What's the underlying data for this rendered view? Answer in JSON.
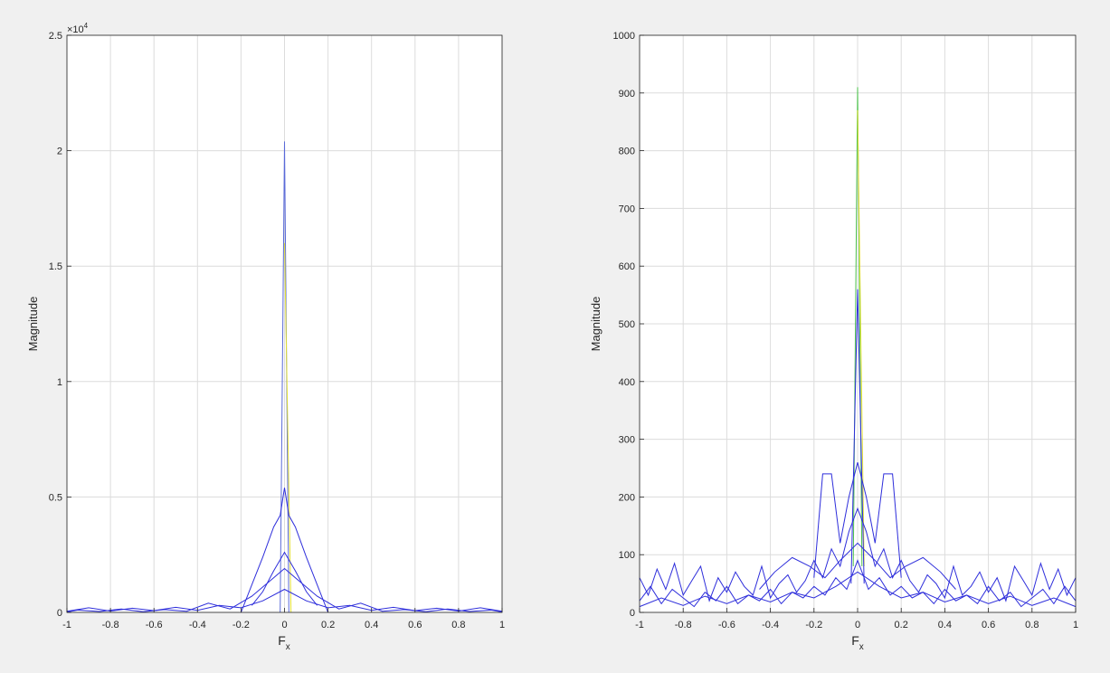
{
  "chart_data": [
    {
      "type": "line",
      "title": "",
      "xlabel": "F",
      "xlabel_sub": "x",
      "ylabel": "Magnitude",
      "xlim": [
        -1,
        1
      ],
      "ylim": [
        0,
        25000
      ],
      "grid": true,
      "y_exponent_label": "×10",
      "y_exponent_power": "4",
      "x_ticks": [
        "-1",
        "-0.8",
        "-0.6",
        "-0.4",
        "-0.2",
        "0",
        "0.2",
        "0.4",
        "0.6",
        "0.8",
        "1"
      ],
      "y_ticks": [
        "0",
        "0.5",
        "1",
        "1.5",
        "2",
        "2.5"
      ],
      "series": [
        {
          "color": "#5a6ad8",
          "x": [
            -0.02,
            0,
            0.02
          ],
          "y": [
            0,
            20400,
            0
          ]
        },
        {
          "color": "#e3e033",
          "x": [
            0,
            0.03
          ],
          "y": [
            16000,
            0
          ]
        },
        {
          "color": "#2e2edb",
          "x": [
            -0.2,
            -0.15,
            -0.1,
            -0.05,
            -0.02,
            0,
            0.02,
            0.05,
            0.1,
            0.15,
            0.2
          ],
          "y": [
            0,
            1200,
            2400,
            3700,
            4200,
            5400,
            4200,
            3700,
            2400,
            1200,
            0
          ]
        },
        {
          "color": "#2e2edb",
          "x": [
            -0.15,
            -0.1,
            -0.05,
            0,
            0.05,
            0.1,
            0.15
          ],
          "y": [
            300,
            900,
            1800,
            2600,
            1800,
            900,
            300
          ]
        },
        {
          "color": "#2e2edb",
          "x": [
            -1,
            -0.9,
            -0.8,
            -0.7,
            -0.6,
            -0.5,
            -0.4,
            -0.3,
            -0.2,
            -0.1,
            0,
            0.1,
            0.2,
            0.3,
            0.4,
            0.5,
            0.6,
            0.7,
            0.8,
            0.9,
            1
          ],
          "y": [
            50,
            200,
            60,
            180,
            80,
            220,
            90,
            300,
            200,
            500,
            1000,
            500,
            200,
            300,
            90,
            220,
            80,
            180,
            60,
            200,
            50
          ]
        },
        {
          "color": "#2e2edb",
          "x": [
            -1,
            -0.95,
            -0.85,
            -0.75,
            -0.65,
            -0.55,
            -0.45,
            -0.35,
            -0.25,
            -0.15,
            -0.05,
            0,
            0.05,
            0.15,
            0.25,
            0.35,
            0.45,
            0.55,
            0.65,
            0.75,
            0.85,
            0.95,
            1
          ],
          "y": [
            20,
            100,
            40,
            150,
            30,
            120,
            50,
            400,
            150,
            700,
            1500,
            1900,
            1500,
            700,
            150,
            400,
            50,
            120,
            30,
            150,
            40,
            100,
            20
          ]
        }
      ]
    },
    {
      "type": "line",
      "title": "",
      "xlabel": "F",
      "xlabel_sub": "x",
      "ylabel": "Magnitude",
      "xlim": [
        -1,
        1
      ],
      "ylim": [
        0,
        1000
      ],
      "grid": true,
      "x_ticks": [
        "-1",
        "-0.8",
        "-0.6",
        "-0.4",
        "-0.2",
        "0",
        "0.2",
        "0.4",
        "0.6",
        "0.8",
        "1"
      ],
      "y_ticks": [
        "0",
        "100",
        "200",
        "300",
        "400",
        "500",
        "600",
        "700",
        "800",
        "900",
        "1000"
      ],
      "series": [
        {
          "color": "#4dc24d",
          "x": [
            -0.02,
            0,
            0.02
          ],
          "y": [
            80,
            910,
            80
          ]
        },
        {
          "color": "#e3e033",
          "x": [
            0,
            0.03
          ],
          "y": [
            870,
            80
          ]
        },
        {
          "color": "#2e2edb",
          "x": [
            -0.03,
            0,
            0.03
          ],
          "y": [
            50,
            560,
            50
          ]
        },
        {
          "color": "#2e2edb",
          "x": [
            -0.2,
            -0.16,
            -0.12,
            -0.08,
            -0.04,
            0,
            0.04,
            0.08,
            0.12,
            0.16,
            0.2
          ],
          "y": [
            60,
            240,
            240,
            120,
            200,
            260,
            200,
            120,
            240,
            240,
            60
          ]
        },
        {
          "color": "#2e2edb",
          "x": [
            -0.45,
            -0.38,
            -0.3,
            -0.22,
            -0.15,
            -0.08,
            0,
            0.08,
            0.15,
            0.22,
            0.3,
            0.38,
            0.45
          ],
          "y": [
            40,
            70,
            95,
            80,
            60,
            90,
            120,
            90,
            60,
            80,
            95,
            70,
            40
          ]
        },
        {
          "color": "#2e2edb",
          "x": [
            -1,
            -0.96,
            -0.92,
            -0.88,
            -0.84,
            -0.8,
            -0.76,
            -0.72,
            -0.68,
            -0.64,
            -0.6,
            -0.56,
            -0.52,
            -0.48,
            -0.44,
            -0.4,
            -0.36,
            -0.32,
            -0.28,
            -0.24,
            -0.2,
            -0.16,
            -0.12,
            -0.08,
            -0.04,
            0,
            0.04,
            0.08,
            0.12,
            0.16,
            0.2,
            0.24,
            0.28,
            0.32,
            0.36,
            0.4,
            0.44,
            0.48,
            0.52,
            0.56,
            0.6,
            0.64,
            0.68,
            0.72,
            0.76,
            0.8,
            0.84,
            0.88,
            0.92,
            0.96,
            1
          ],
          "y": [
            60,
            30,
            75,
            40,
            85,
            30,
            55,
            80,
            20,
            60,
            35,
            70,
            45,
            30,
            80,
            25,
            50,
            65,
            35,
            55,
            90,
            60,
            110,
            80,
            140,
            180,
            140,
            80,
            110,
            60,
            90,
            55,
            35,
            65,
            50,
            25,
            80,
            30,
            45,
            70,
            35,
            60,
            20,
            80,
            55,
            30,
            85,
            40,
            75,
            30,
            60
          ]
        },
        {
          "color": "#2e2edb",
          "x": [
            -1,
            -0.95,
            -0.9,
            -0.85,
            -0.8,
            -0.75,
            -0.7,
            -0.65,
            -0.6,
            -0.55,
            -0.5,
            -0.45,
            -0.4,
            -0.35,
            -0.3,
            -0.25,
            -0.2,
            -0.15,
            -0.1,
            -0.05,
            0,
            0.05,
            0.1,
            0.15,
            0.2,
            0.25,
            0.3,
            0.35,
            0.4,
            0.45,
            0.5,
            0.55,
            0.6,
            0.65,
            0.7,
            0.75,
            0.8,
            0.85,
            0.9,
            0.95,
            1
          ],
          "y": [
            20,
            45,
            15,
            40,
            25,
            10,
            35,
            20,
            45,
            15,
            30,
            20,
            40,
            15,
            35,
            25,
            45,
            30,
            60,
            40,
            90,
            40,
            60,
            30,
            45,
            25,
            35,
            15,
            40,
            20,
            30,
            15,
            45,
            20,
            35,
            10,
            25,
            40,
            15,
            45,
            20
          ]
        },
        {
          "color": "#2e2edb",
          "x": [
            -1,
            -0.9,
            -0.8,
            -0.7,
            -0.6,
            -0.5,
            -0.4,
            -0.3,
            -0.2,
            -0.1,
            0,
            0.1,
            0.2,
            0.3,
            0.4,
            0.5,
            0.6,
            0.7,
            0.8,
            0.9,
            1
          ],
          "y": [
            10,
            25,
            12,
            28,
            15,
            30,
            18,
            35,
            25,
            45,
            70,
            45,
            25,
            35,
            18,
            30,
            15,
            28,
            12,
            25,
            10
          ]
        }
      ]
    }
  ]
}
